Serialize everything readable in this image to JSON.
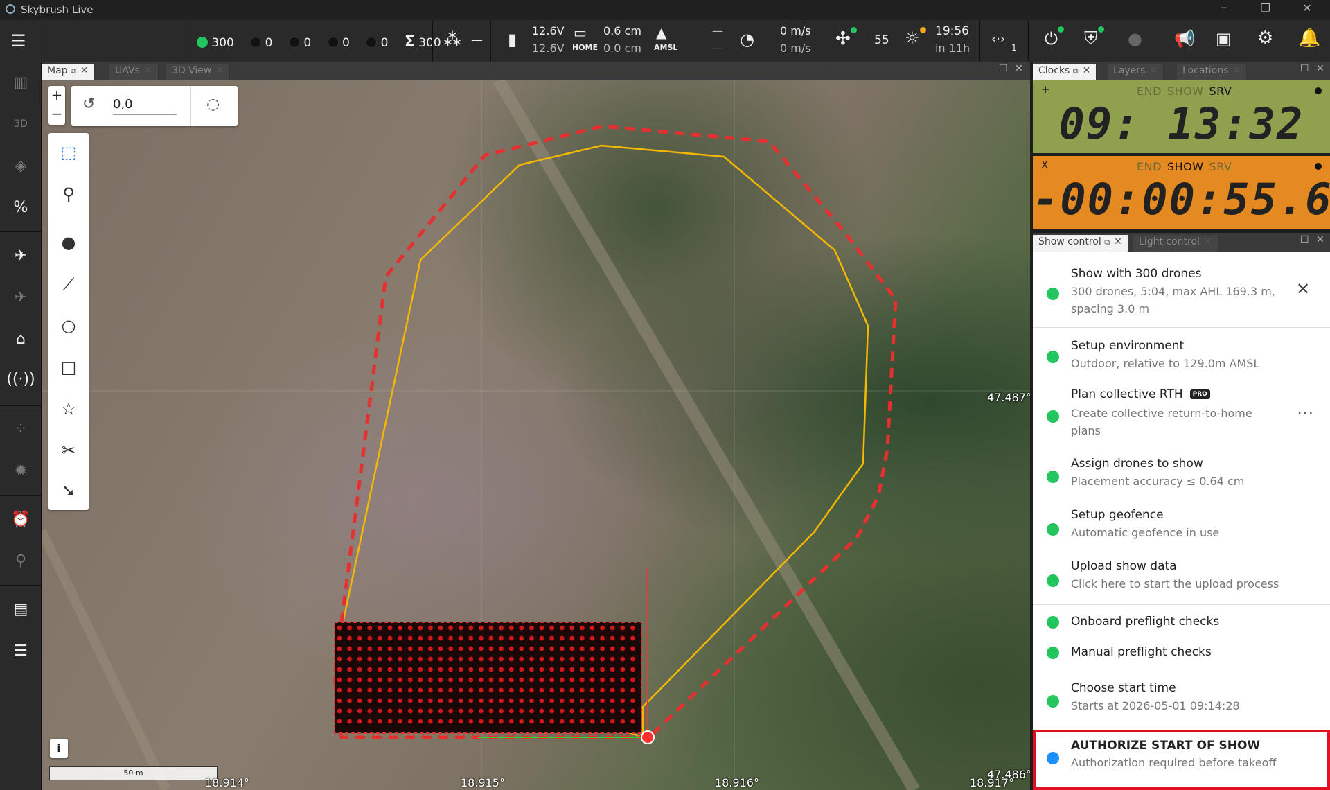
{
  "window": {
    "title": "Skybrush Live"
  },
  "toolbar": {
    "uav_active": "300",
    "uav_c1": "0",
    "uav_c2": "0",
    "uav_c3": "0",
    "uav_c4": "0",
    "uav_total": "300",
    "group_dash": "—",
    "battery_top": "12.6V",
    "battery_bottom": "12.6V",
    "home_top": "0.6 cm",
    "home_bottom": "0.0 cm",
    "home_label": "HOME",
    "amsl_label": "AMSL",
    "amsl_top": "—",
    "amsl_bottom": "—",
    "speed_top": "0 m/s",
    "speed_bottom": "0 m/s",
    "gps_count": "55",
    "sunset_time": "19:56",
    "sunset_rel": "in 11h",
    "rtk_sub": "1"
  },
  "map_tabs": [
    {
      "label": "Map"
    },
    {
      "label": "UAVs"
    },
    {
      "label": "3D View"
    }
  ],
  "map": {
    "rotation_value": "0,0",
    "scale_label": "50 m",
    "info_label": "i",
    "lon_labels": [
      "18.914°",
      "18.915°",
      "18.916°",
      "18.917°"
    ],
    "lat_labels": [
      "47.487°",
      "47.486°"
    ]
  },
  "right_tabs_top": [
    {
      "label": "Clocks"
    },
    {
      "label": "Layers"
    },
    {
      "label": "Locations"
    }
  ],
  "clocks": [
    {
      "corner": "+",
      "labels": [
        "END",
        "SHOW",
        "SRV"
      ],
      "active": "SRV",
      "time": "09: 13:32",
      "bg": "#8fa04f"
    },
    {
      "corner": "X",
      "labels": [
        "END",
        "SHOW",
        "SRV"
      ],
      "active": "SHOW",
      "time": "-00:00:55.6",
      "bg": "#e58a20"
    }
  ],
  "right_tabs_bottom": [
    {
      "label": "Show control"
    },
    {
      "label": "Light control"
    }
  ],
  "show_steps": [
    {
      "title": "Show with 300 drones",
      "sub": "300 drones, 5:04, max AHL 169.3 m,",
      "sub2": "spacing 3.0 m"
    },
    {
      "title": "Setup environment",
      "sub": "Outdoor, relative to 129.0m AMSL"
    },
    {
      "title": "Plan collective RTH",
      "badge": "PRO",
      "sub": "Create collective return-to-home",
      "sub2": "plans"
    },
    {
      "title": "Assign drones to show",
      "sub": "Placement accuracy ≤ 0.64 cm"
    },
    {
      "title": "Setup geofence",
      "sub": "Automatic geofence in use"
    },
    {
      "title": "Upload show data",
      "sub": "Click here to start the upload process"
    },
    {
      "title": "Onboard preflight checks"
    },
    {
      "title": "Manual preflight checks"
    },
    {
      "title": "Choose start time",
      "sub": "Starts at 2026-05-01 09:14:28"
    },
    {
      "title": "AUTHORIZE START OF SHOW",
      "sub": "Authorization required before takeoff"
    }
  ],
  "colors": {
    "ok": "#22c55e",
    "pending": "#1e90ff",
    "highlight": "#e01020",
    "geofence": "#e53030",
    "convex_hull": "#f5b800"
  }
}
